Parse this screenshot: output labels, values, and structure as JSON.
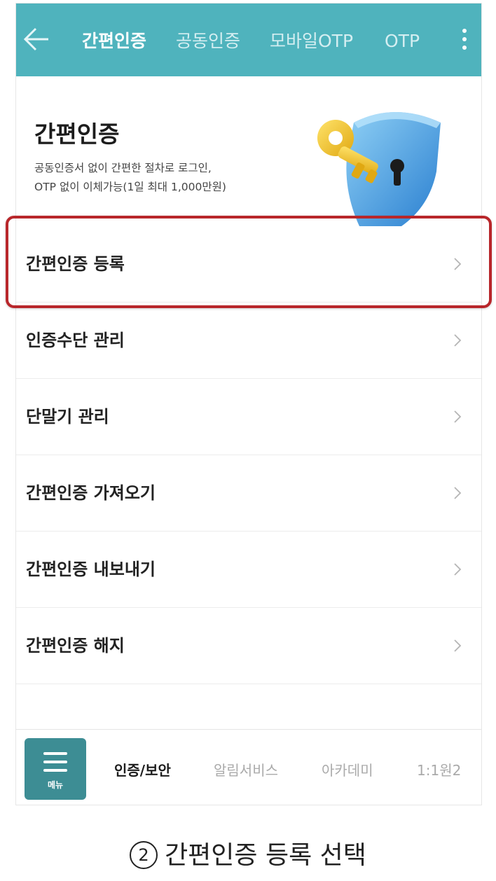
{
  "header": {
    "back_icon": "arrow-left-icon",
    "tabs": [
      {
        "label": "간편인증",
        "active": true
      },
      {
        "label": "공동인증",
        "active": false
      },
      {
        "label": "모바일OTP",
        "active": false
      },
      {
        "label": "OTP",
        "active": false
      }
    ],
    "more_icon": "kebab-menu-icon",
    "bg_color": "#4fb3bd"
  },
  "hero": {
    "title": "간편인증",
    "desc_line1": "공동인증서 없이 간편한 절차로 로그인,",
    "desc_line2": "OTP 없이 이체가능(1일 최대 1,000만원)",
    "illustration": "shield-key-icon"
  },
  "menu": {
    "items": [
      {
        "label": "간편인증 등록"
      },
      {
        "label": "인증수단 관리"
      },
      {
        "label": "단말기 관리"
      },
      {
        "label": "간편인증 가져오기"
      },
      {
        "label": "간편인증 내보내기"
      },
      {
        "label": "간편인증 해지"
      }
    ],
    "chevron_icon": "chevron-right-icon",
    "highlight_color": "#b8272b"
  },
  "bottom_bar": {
    "menu_button_label": "메뉴",
    "menu_icon": "hamburger-icon",
    "tabs": [
      {
        "label": "인증/보안",
        "active": true
      },
      {
        "label": "알림서비스",
        "active": false
      },
      {
        "label": "아카데미",
        "active": false
      },
      {
        "label": "1:1원2",
        "active": false
      }
    ]
  },
  "caption": {
    "step_number": "2",
    "text": "간편인증 등록 선택"
  }
}
